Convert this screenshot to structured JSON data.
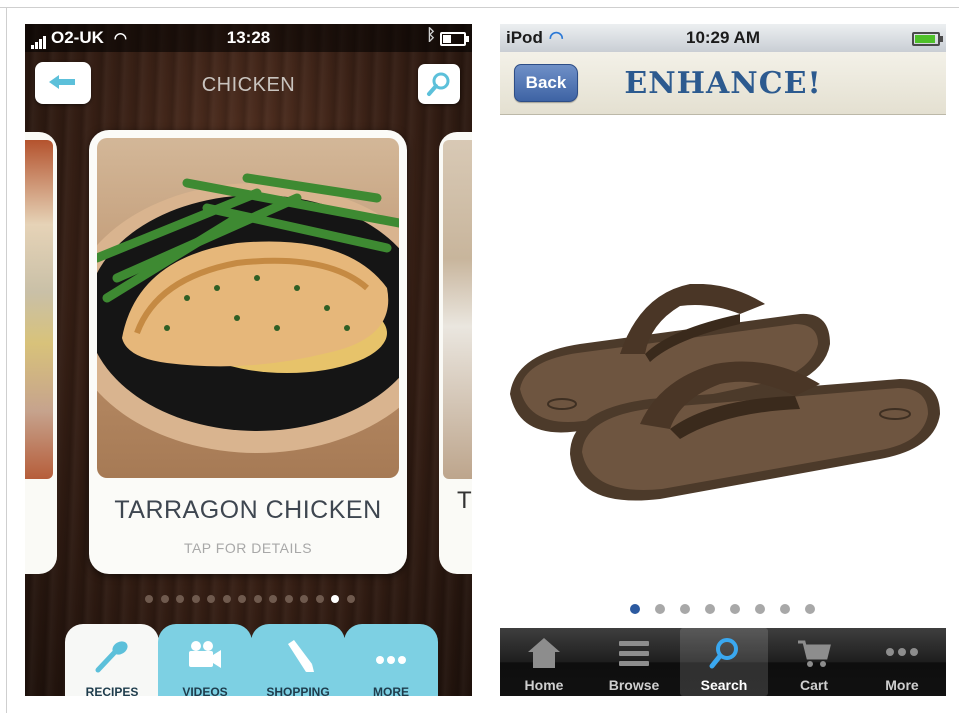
{
  "left_app": {
    "status_bar": {
      "carrier": "O2-UK",
      "time": "13:28"
    },
    "header": {
      "title": "CHICKEN",
      "back_icon": "arrow-left-icon",
      "search_icon": "magnifier-icon"
    },
    "card": {
      "title": "TARRAGON CHICKEN",
      "subtitle": "TAP FOR DETAILS",
      "next_card_peek": "T"
    },
    "pager": {
      "total": 14,
      "active": 13
    },
    "tabs": [
      {
        "label": "RECIPES",
        "icon": "spoon-icon",
        "active": true
      },
      {
        "label": "VIDEOS",
        "icon": "video-camera-icon",
        "active": false
      },
      {
        "label": "SHOPPING",
        "icon": "pencil-icon",
        "active": false
      },
      {
        "label": "MORE",
        "icon": "more-dots-icon",
        "active": false
      }
    ],
    "colors": {
      "tab": "#7dd0e3",
      "tab_active": "#f7f8f6",
      "card_text": "#3e4650"
    }
  },
  "right_app": {
    "status_bar": {
      "carrier": "iPod",
      "time": "10:29 AM"
    },
    "nav": {
      "back_label": "Back",
      "title": "ENHANCE!"
    },
    "pager": {
      "total": 8,
      "active": 1
    },
    "tabs": [
      {
        "label": "Home",
        "icon": "house-icon",
        "active": false
      },
      {
        "label": "Browse",
        "icon": "list-icon",
        "active": false
      },
      {
        "label": "Search",
        "icon": "magnifier-icon",
        "active": true
      },
      {
        "label": "Cart",
        "icon": "cart-icon",
        "active": false
      },
      {
        "label": "More",
        "icon": "more-dots-icon",
        "active": false
      }
    ],
    "colors": {
      "title": "#2c5a8f",
      "back_button": "#4f72b3",
      "active_dot": "#2c5aa0"
    }
  }
}
